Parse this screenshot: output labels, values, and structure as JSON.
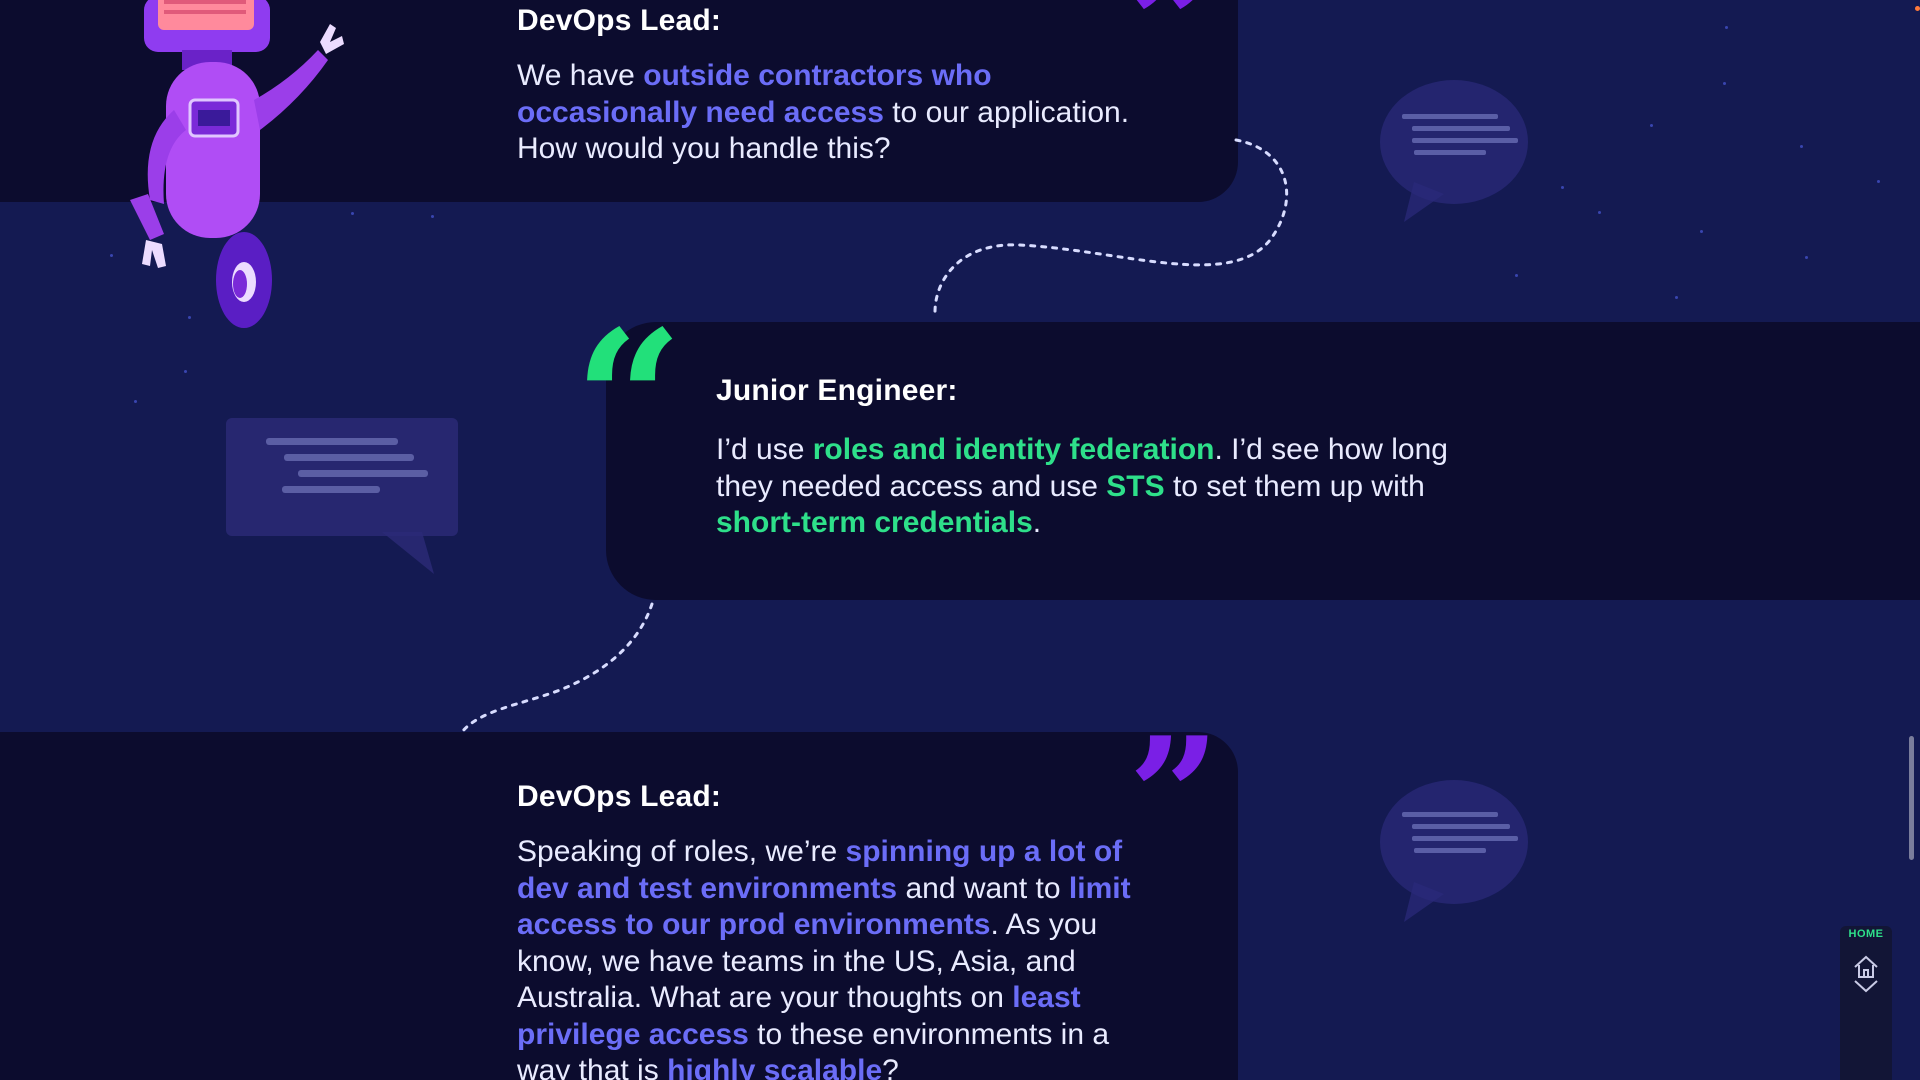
{
  "conversation": [
    {
      "speaker": "DevOps Lead:",
      "segments": [
        {
          "t": "We have ",
          "h": ""
        },
        {
          "t": "outside contractors who",
          "h": "blue"
        },
        {
          "t": "\n",
          "h": ""
        },
        {
          "t": "occasionally need access",
          "h": "blue"
        },
        {
          "t": " to our application.\nHow would you handle this?",
          "h": ""
        }
      ]
    },
    {
      "speaker": "Junior Engineer:",
      "segments": [
        {
          "t": "I’d use ",
          "h": ""
        },
        {
          "t": "roles and identity federation",
          "h": "green"
        },
        {
          "t": ". I’d see how long\nthey needed access and use ",
          "h": ""
        },
        {
          "t": "STS",
          "h": "green"
        },
        {
          "t": " to set them up with\n",
          "h": ""
        },
        {
          "t": "short-term credentials",
          "h": "green"
        },
        {
          "t": ".",
          "h": ""
        }
      ]
    },
    {
      "speaker": "DevOps Lead:",
      "segments": [
        {
          "t": "Speaking of roles, we’re ",
          "h": ""
        },
        {
          "t": "spinning up a lot of",
          "h": "blue"
        },
        {
          "t": "\n",
          "h": ""
        },
        {
          "t": "dev and test environments",
          "h": "blue"
        },
        {
          "t": " and want to ",
          "h": ""
        },
        {
          "t": "limit",
          "h": "blue"
        },
        {
          "t": "\n",
          "h": ""
        },
        {
          "t": "access to our prod environments",
          "h": "blue"
        },
        {
          "t": ". As you\nknow, we have teams in the US, Asia, and\nAustralia. What are your thoughts on ",
          "h": ""
        },
        {
          "t": "least",
          "h": "blue"
        },
        {
          "t": "\n",
          "h": ""
        },
        {
          "t": "privilege access",
          "h": "blue"
        },
        {
          "t": " to these environments in a\nway that is ",
          "h": ""
        },
        {
          "t": "highly scalable",
          "h": "blue"
        },
        {
          "t": "?",
          "h": ""
        }
      ]
    }
  ],
  "nav": {
    "home_label": "HOME",
    "home_icon": "home-icon",
    "down_icon": "chevron-down-icon"
  },
  "colors": {
    "background": "#141a52",
    "card": "#0c0c2e",
    "highlight_blue": "#6b6df7",
    "highlight_green": "#2ee08a",
    "quote_purple": "#7a1fe6",
    "quote_green": "#22e07a"
  }
}
